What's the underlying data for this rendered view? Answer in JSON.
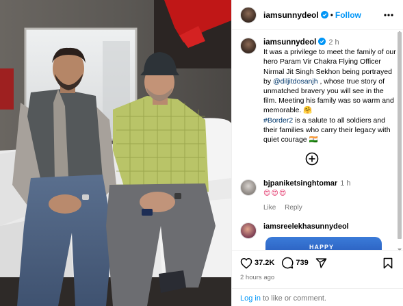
{
  "post": {
    "username": "iamsunnydeol",
    "follow_label": "Follow",
    "dot": "•"
  },
  "caption": {
    "username": "iamsunnydeol",
    "time": "2 h",
    "text_before_mention": "It was a privilege to meet the family of our hero Param Vir Chakra Flying Officer Nirmal Jit Singh Sekhon being portrayed by ",
    "mention": "@diljitdosanjh",
    "text_after_mention": " , whose true story of unmatched bravery you will see in the film. Meeting his family was so warm and memorable. 🤗",
    "hashtag": "#Border2",
    "text_after_hashtag": " is a salute to all soldiers and their families who carry their legacy with quiet courage 🇮🇳"
  },
  "comments": [
    {
      "username": "bjpaniketsinghtomar",
      "time": "1 h",
      "text": "😍😍😍",
      "like_label": "Like",
      "reply_label": "Reply"
    },
    {
      "username": "iamsreelekhasunnydeol",
      "image_text": "HAPPY"
    }
  ],
  "actions": {
    "likes": "37.2K",
    "comments": "739",
    "time_ago": "2 hours ago",
    "login_link": "Log in",
    "login_suffix": " to like or comment."
  },
  "colors": {
    "accent": "#0095f6",
    "link": "#00376b",
    "muted": "#737373"
  },
  "icons": [
    "verified-badge-icon",
    "more-options-icon",
    "add-circle-icon",
    "heart-icon",
    "comment-icon",
    "share-icon",
    "bookmark-icon"
  ]
}
